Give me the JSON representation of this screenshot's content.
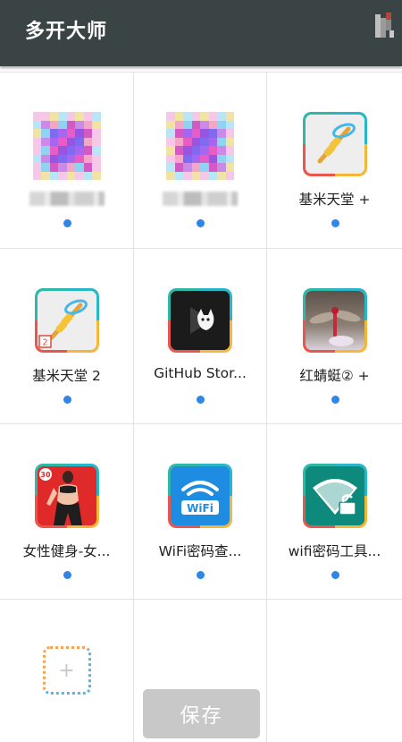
{
  "header": {
    "title": "多开大师",
    "menu_icon": "overflow-menu-icon"
  },
  "apps": [
    {
      "label": "",
      "icon": "blurred-app-icon"
    },
    {
      "label": "",
      "icon": "blurred-app-icon"
    },
    {
      "label": "基米天堂 +",
      "icon": "kebab-skewer-icon"
    },
    {
      "label": "基米天堂 2",
      "icon": "kebab-skewer-icon",
      "badge": "2"
    },
    {
      "label": "GitHub Stor...",
      "icon": "cat-play-icon"
    },
    {
      "label": "红蜻蜓② +",
      "icon": "dragonfly-photo-icon"
    },
    {
      "label": "女性健身-女...",
      "icon": "fitness-woman-icon",
      "badge": "30"
    },
    {
      "label": "WiFi密码查...",
      "icon": "wifi-badge-icon",
      "wifi_text": "WiFi"
    },
    {
      "label": "wifi密码工具...",
      "icon": "wifi-lock-icon"
    }
  ],
  "add_tile": {
    "symbol": "+"
  },
  "save_button": {
    "label": "保存"
  },
  "colors": {
    "header_bg": "#3a4445",
    "dot": "#2f86e6",
    "save_bg": "#c8c8c8"
  }
}
